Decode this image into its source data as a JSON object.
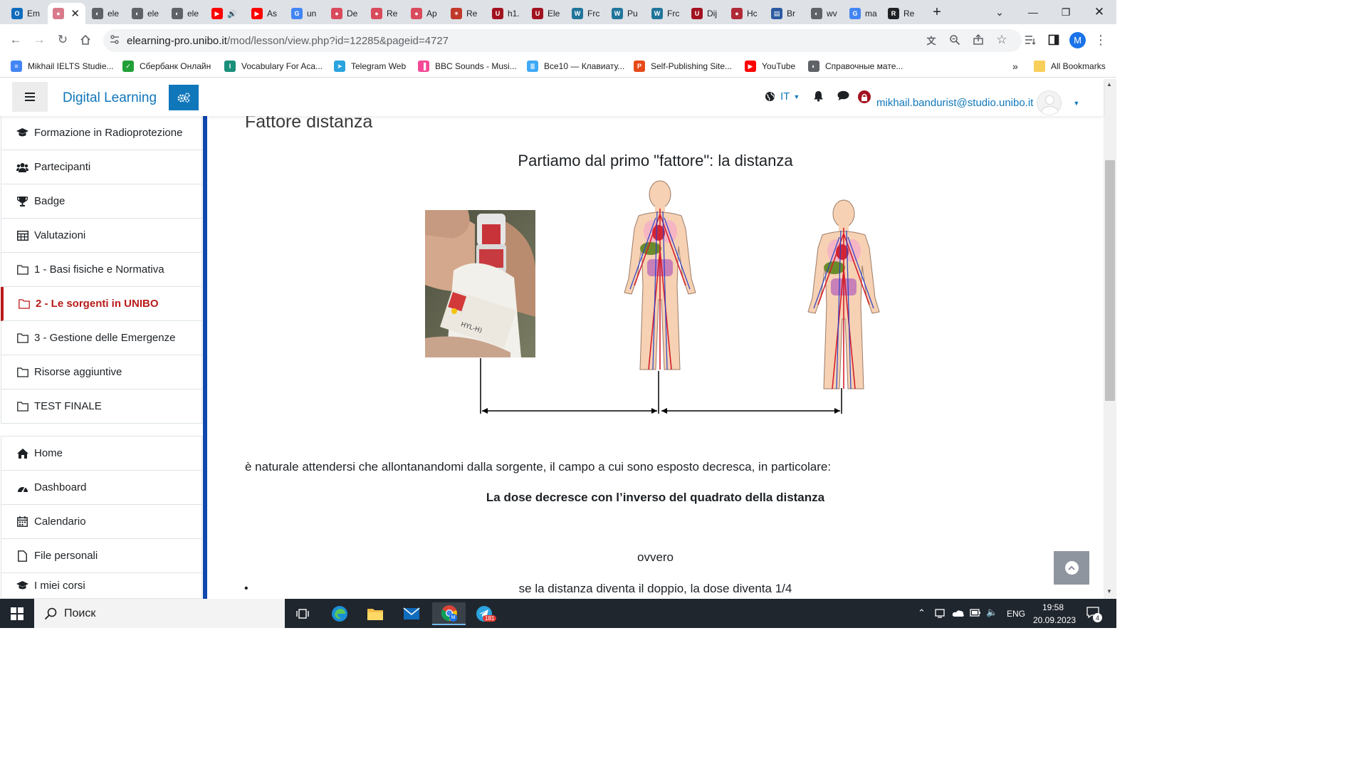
{
  "browser": {
    "tabs": [
      {
        "label": "Em",
        "icon": "outlook-icon",
        "color": "#0f6cbd"
      },
      {
        "label": "",
        "icon": "unibo-seal-icon",
        "color": "#d97a8a",
        "active": true
      },
      {
        "label": "ele",
        "icon": "globe-icon",
        "color": "#5f6368"
      },
      {
        "label": "ele",
        "icon": "globe-icon",
        "color": "#5f6368"
      },
      {
        "label": "ele",
        "icon": "globe-icon",
        "color": "#5f6368"
      },
      {
        "label": "",
        "icon": "youtube-icon",
        "color": "#ff0000"
      },
      {
        "label": "As",
        "icon": "youtube-icon",
        "color": "#ff0000"
      },
      {
        "label": "un",
        "icon": "google-icon",
        "color": "#4285f4"
      },
      {
        "label": "De",
        "icon": "unibo-seal-icon",
        "color": "#d94b5c"
      },
      {
        "label": "Re",
        "icon": "unibo-seal-icon",
        "color": "#d94b5c"
      },
      {
        "label": "Ap",
        "icon": "unibo-seal-icon",
        "color": "#d94b5c"
      },
      {
        "label": "Re",
        "icon": "radiation-site-icon",
        "color": "#c0392b"
      },
      {
        "label": "h1.",
        "icon": "shield-icon",
        "color": "#a2121f"
      },
      {
        "label": "Ele",
        "icon": "shield-icon",
        "color": "#a2121f"
      },
      {
        "label": "Frc",
        "icon": "wordpress-icon",
        "color": "#21759b"
      },
      {
        "label": "Pu",
        "icon": "wordpress-icon",
        "color": "#21759b"
      },
      {
        "label": "Frc",
        "icon": "wordpress-icon",
        "color": "#21759b"
      },
      {
        "label": "Dij",
        "icon": "shield-icon",
        "color": "#a2121f"
      },
      {
        "label": "Hc",
        "icon": "unibo-seal-icon",
        "color": "#b02a37"
      },
      {
        "label": "Br",
        "icon": "chart-site-icon",
        "color": "#2c5aa0"
      },
      {
        "label": "wv",
        "icon": "globe-icon",
        "color": "#5f6368"
      },
      {
        "label": "ma",
        "icon": "google-icon",
        "color": "#4285f4"
      },
      {
        "label": "Re",
        "icon": "r6-icon",
        "color": "#202124"
      }
    ],
    "new_tab": "+",
    "url_host": "elearning-pro.unibo.it",
    "url_path": "/mod/lesson/view.php?id=12285&pageid=4727",
    "profile_initial": "M",
    "bookmarks": [
      {
        "label": "Mikhail IELTS Studie...",
        "icon": "docs-icon",
        "color": "#4285f4"
      },
      {
        "label": "Сбербанк Онлайн",
        "icon": "sber-icon",
        "color": "#21a038"
      },
      {
        "label": "Vocabulary For Aca...",
        "icon": "ielts-icon",
        "color": "#1a8f7a"
      },
      {
        "label": "Telegram Web",
        "icon": "telegram-icon",
        "color": "#2aa3df"
      },
      {
        "label": "BBC Sounds - Musi...",
        "icon": "bbc-icon",
        "color": "#f54997"
      },
      {
        "label": "Все10 — Клавиату...",
        "icon": "vse10-icon",
        "color": "#3fa9f5"
      },
      {
        "label": "Self-Publishing Site...",
        "icon": "p-icon",
        "color": "#e64a19"
      },
      {
        "label": "YouTube",
        "icon": "youtube-icon",
        "color": "#ff0000"
      },
      {
        "label": "Справочные мате...",
        "icon": "globe-icon",
        "color": "#5f6368"
      }
    ],
    "bookmarks_more": "»",
    "all_bookmarks": "All Bookmarks"
  },
  "navbar": {
    "site_name": "Digital Learning",
    "language": "IT",
    "user_email": "mikhail.bandurist@studio.unibo.it"
  },
  "sidebar": {
    "course_items": [
      {
        "label": "Formazione in Radioprotezione",
        "icon": "graduation-cap-icon"
      },
      {
        "label": "Partecipanti",
        "icon": "users-icon"
      },
      {
        "label": "Badge",
        "icon": "trophy-icon"
      },
      {
        "label": "Valutazioni",
        "icon": "table-icon"
      },
      {
        "label": "1 - Basi fisiche e Normativa",
        "icon": "folder-icon"
      },
      {
        "label": "2 - Le sorgenti in UNIBO",
        "icon": "folder-icon",
        "active": true
      },
      {
        "label": "3 - Gestione delle Emergenze",
        "icon": "folder-icon"
      },
      {
        "label": "Risorse aggiuntive",
        "icon": "folder-icon"
      },
      {
        "label": "TEST FINALE",
        "icon": "folder-icon"
      }
    ],
    "site_items": [
      {
        "label": "Home",
        "icon": "home-icon"
      },
      {
        "label": "Dashboard",
        "icon": "dashboard-icon"
      },
      {
        "label": "Calendario",
        "icon": "calendar-icon"
      },
      {
        "label": "File personali",
        "icon": "file-icon"
      },
      {
        "label": "I miei corsi",
        "icon": "graduation-cap-icon"
      }
    ]
  },
  "lesson": {
    "title": "Fattore distanza",
    "subtitle": "Partiamo dal primo \"fattore\": la distanza",
    "paragraph": "è naturale attendersi che allontanandomi dalla sorgente, il campo a cui sono esposto decresca, in particolare:",
    "bold_rule": "La dose decresce con l’inverso del quadrato della distanza",
    "ovvero": "ovvero",
    "bullet": "se la distanza diventa il doppio, la dose diventa 1/4",
    "vial_label": "HYL-H)"
  },
  "taskbar": {
    "search_placeholder": "Поиск",
    "language": "ENG",
    "time": "19:58",
    "date": "20.09.2023",
    "telegram_badge": "181",
    "notification_count": "4"
  },
  "colors": {
    "moodle_blue": "#1077bb",
    "active_red": "#b81b19",
    "sidebar_border": "#0f47ad",
    "taskbar": "#20262e"
  }
}
